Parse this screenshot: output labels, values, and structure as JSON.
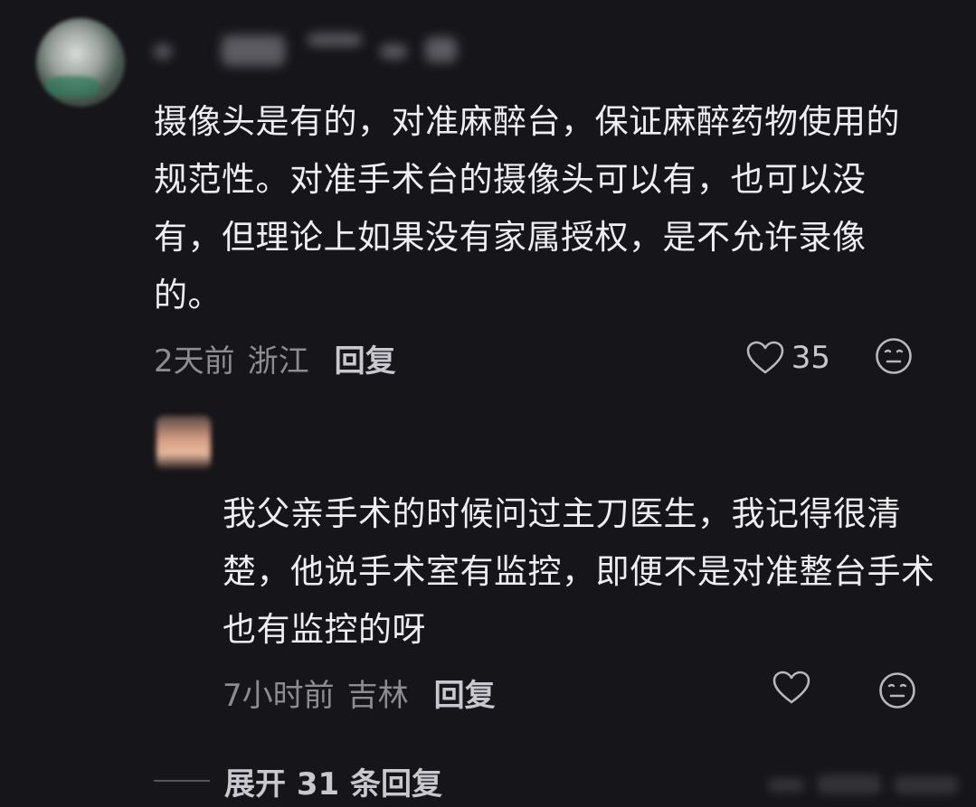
{
  "comment": {
    "text": "摄像头是有的，对准麻醉台，保证麻醉药物使用的规范性。对准手术台的摄像头可以有，也可以没有，但理论上如果没有家属授权，是不允许录像的。",
    "time": "2天前",
    "location": "浙江",
    "reply_label": "回复",
    "like_count": "35",
    "like_icon": "heart-icon",
    "emoji_icon": "meh-face-icon"
  },
  "reply": {
    "text": "我父亲手术的时候问过主刀医生，我记得很清楚，他说手术室有监控，即便不是对准整台手术也有监控的呀",
    "time": "7小时前",
    "location": "吉林",
    "reply_label": "回复",
    "like_icon": "heart-icon",
    "emoji_icon": "meh-face-icon"
  },
  "expand": {
    "label": "展开 31 条回复"
  },
  "colors": {
    "background": "#161519",
    "text_primary": "#eeedf1",
    "text_secondary": "#8d8c93"
  }
}
